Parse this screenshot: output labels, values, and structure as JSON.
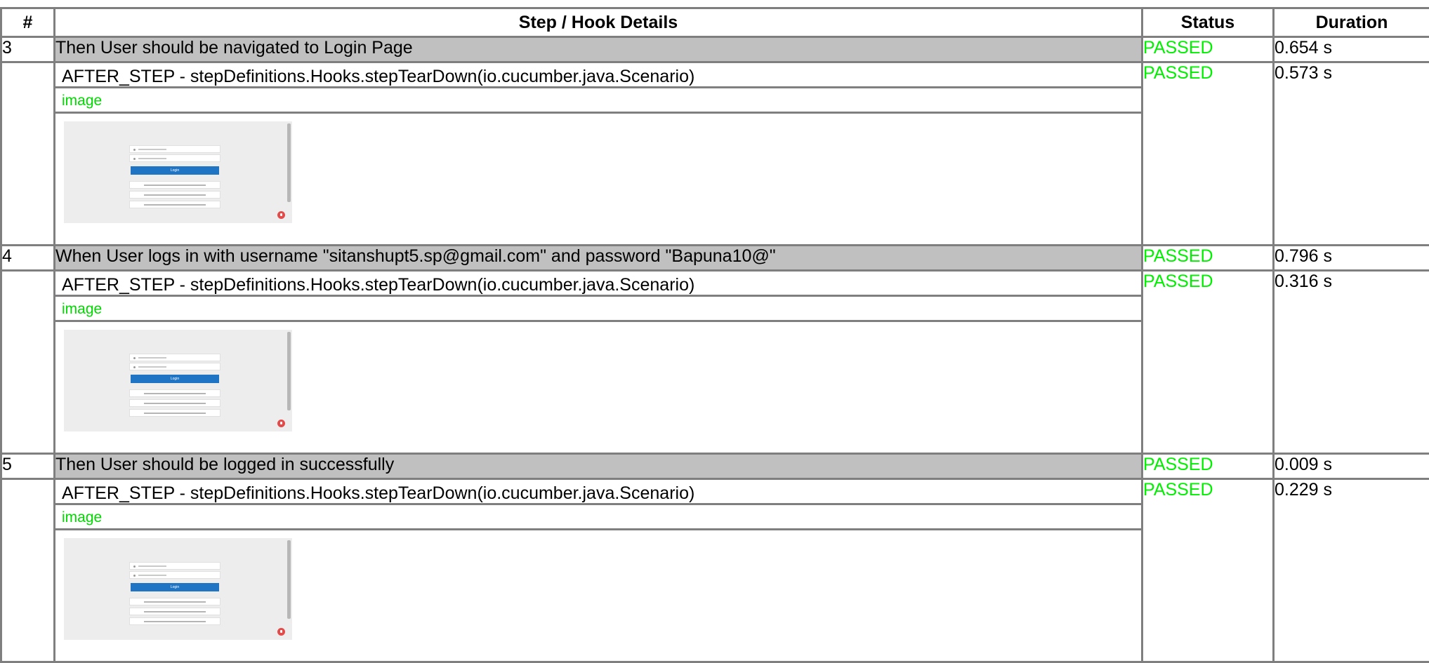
{
  "headers": {
    "num": "#",
    "details": "Step / Hook Details",
    "status": "Status",
    "duration": "Duration"
  },
  "steps": [
    {
      "num": "3",
      "title": "Then User should be navigated to Login Page",
      "status": "PASSED",
      "duration": "0.654 s",
      "hook": {
        "title": "AFTER_STEP - stepDefinitions.Hooks.stepTearDown(io.cucumber.java.Scenario)",
        "status": "PASSED",
        "duration": "0.573 s",
        "image_label": "image",
        "login_label": "Login"
      }
    },
    {
      "num": "4",
      "title": "When User logs in with username \"sitanshupt5.sp@gmail.com\" and password \"Bapuna10@\"",
      "status": "PASSED",
      "duration": "0.796 s",
      "hook": {
        "title": "AFTER_STEP - stepDefinitions.Hooks.stepTearDown(io.cucumber.java.Scenario)",
        "status": "PASSED",
        "duration": "0.316 s",
        "image_label": "image",
        "login_label": "Login"
      }
    },
    {
      "num": "5",
      "title": "Then User should be logged in successfully",
      "status": "PASSED",
      "duration": "0.009 s",
      "hook": {
        "title": "AFTER_STEP - stepDefinitions.Hooks.stepTearDown(io.cucumber.java.Scenario)",
        "status": "PASSED",
        "duration": "0.229 s",
        "image_label": "image",
        "login_label": "Login"
      }
    }
  ],
  "colors": {
    "passed": "#00f000",
    "step_row_bg": "#c0c0c0",
    "border": "#7f7f7f",
    "login_button": "#1f74c4"
  }
}
